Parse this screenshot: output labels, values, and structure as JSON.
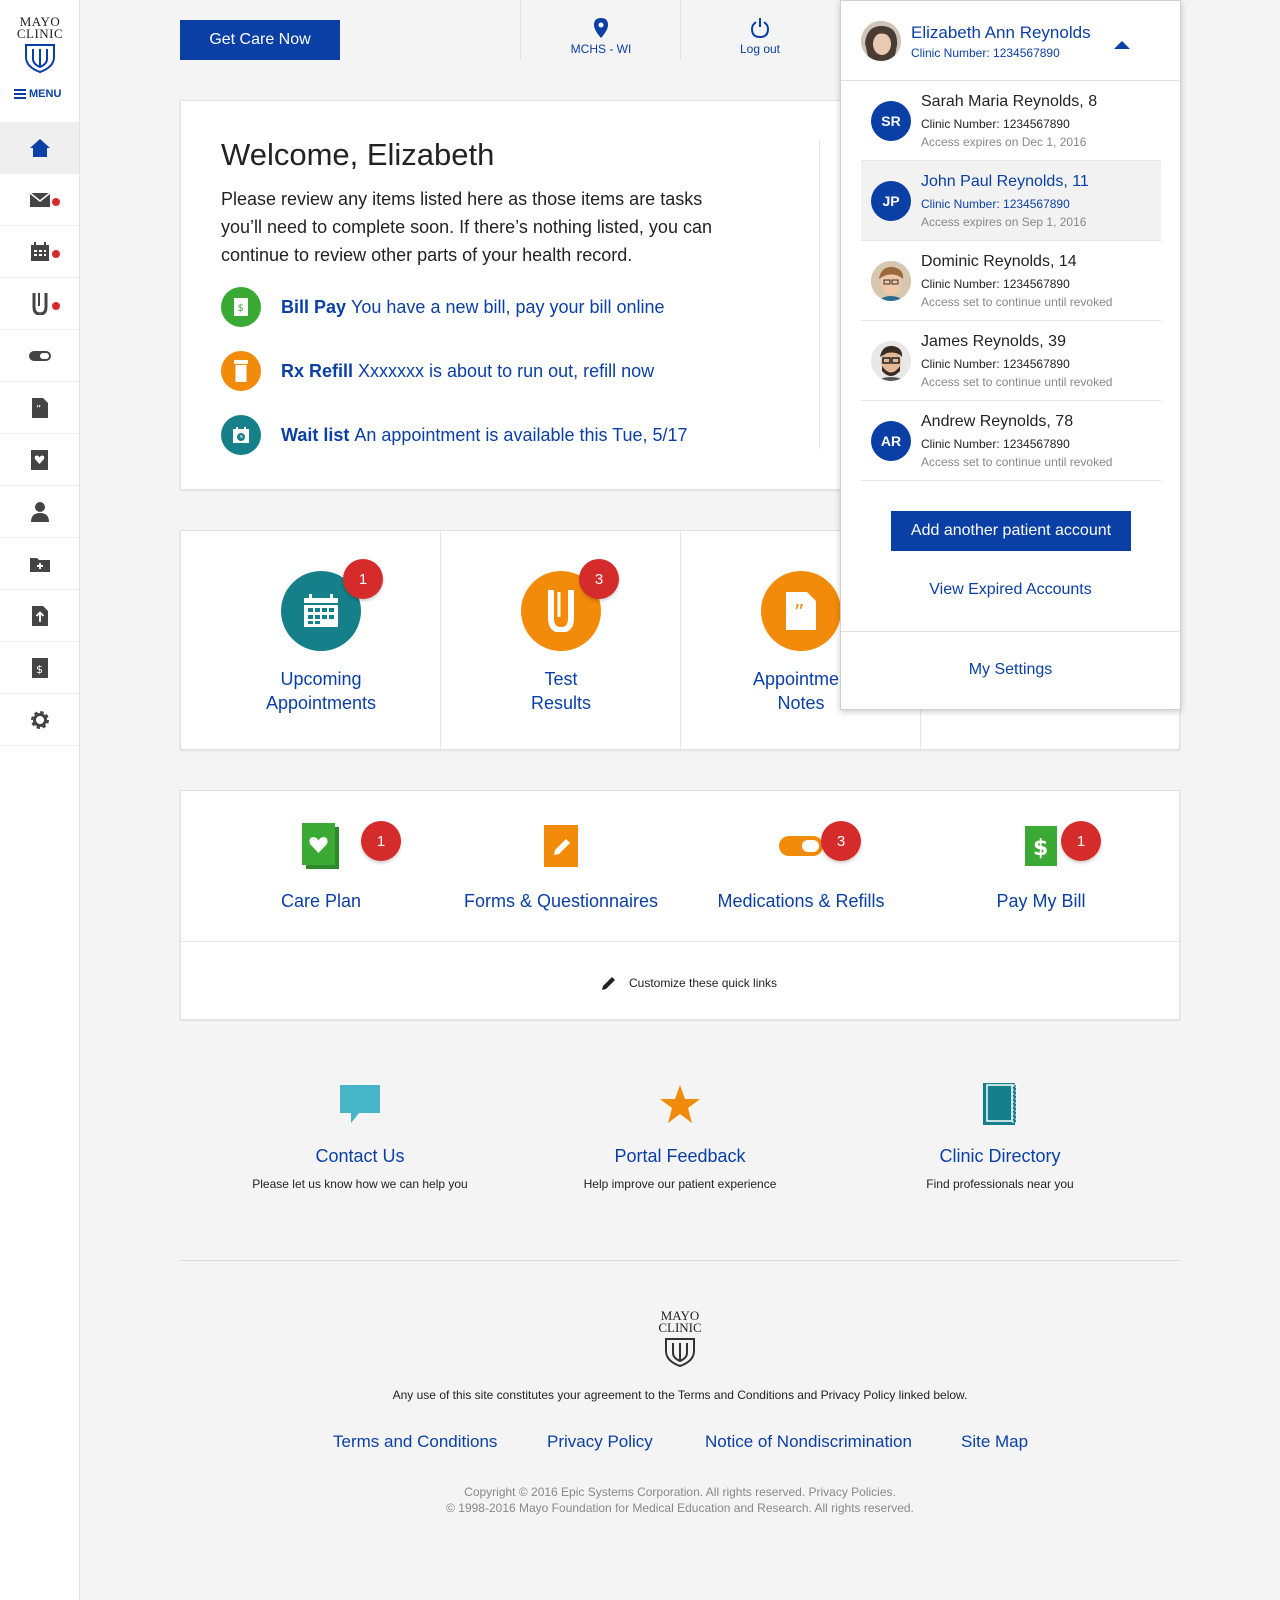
{
  "brand": {
    "logo_line1": "MAYO",
    "logo_line2": "CLINIC",
    "menu_label": "MENU"
  },
  "colors": {
    "primary": "#0a3fa6",
    "alert": "#d52b2b",
    "green": "#3aaa35",
    "orange": "#f28a0a",
    "teal": "#157f8a"
  },
  "sidebar": {
    "items": [
      {
        "icon": "home-icon",
        "active": true,
        "dot": false
      },
      {
        "icon": "mail-icon",
        "dot": true
      },
      {
        "icon": "calendar-icon",
        "dot": true
      },
      {
        "icon": "test-tube-icon",
        "dot": true
      },
      {
        "icon": "pill-icon",
        "dot": false
      },
      {
        "icon": "notes-icon",
        "dot": false
      },
      {
        "icon": "care-plan-icon",
        "dot": false
      },
      {
        "icon": "doctor-icon",
        "dot": false
      },
      {
        "icon": "folder-plus-icon",
        "dot": false
      },
      {
        "icon": "upload-icon",
        "dot": false
      },
      {
        "icon": "bill-icon",
        "dot": false
      },
      {
        "icon": "gear-icon",
        "dot": false
      }
    ]
  },
  "topbar": {
    "get_care": "Get Care Now",
    "location": "MCHS - WI",
    "logout": "Log out"
  },
  "welcome": {
    "title": "Welcome, Elizabeth",
    "body": "Please review any items listed here as those items are tasks you’ll need to complete soon. If there’s nothing listed, you can continue to review other parts of your health record.",
    "tasks": [
      {
        "title": "Bill Pay",
        "text": "You have a new bill, pay your bill online",
        "color": "#3aaa35",
        "icon": "dollar-icon"
      },
      {
        "title": "Rx Refill",
        "text": "Xxxxxxx is about to run out, refill now",
        "color": "#f28a0a",
        "icon": "pill-bottle-icon"
      },
      {
        "title": "Wait list",
        "text": "An appointment is available this Tue, 5/17",
        "color": "#157f8a",
        "icon": "clock-calendar-icon"
      }
    ]
  },
  "summary": [
    {
      "line1": "Upcoming",
      "line2": "Appointments",
      "badge": "1",
      "color": "#157f8a"
    },
    {
      "line1": "Test",
      "line2": "Results",
      "badge": "3",
      "color": "#f28a0a"
    },
    {
      "line1": "Appointmen",
      "line2": "Notes",
      "badge": "",
      "color": "#f28a0a"
    }
  ],
  "quick_links": [
    {
      "label": "Care Plan",
      "badge": "1"
    },
    {
      "label": "Forms & Questionnaires",
      "badge": ""
    },
    {
      "label": "Medications & Refills",
      "badge": "3"
    },
    {
      "label": "Pay My Bill",
      "badge": "1"
    }
  ],
  "customize_label": "Customize these quick links",
  "help": [
    {
      "title": "Contact Us",
      "sub": "Please let us know how we can help you"
    },
    {
      "title": "Portal Feedback",
      "sub": "Help improve our patient experience"
    },
    {
      "title": "Clinic Directory",
      "sub": "Find professionals near you"
    }
  ],
  "footer": {
    "note": "Any use of this site constitutes your agreement to the Terms and Conditions and Privacy Policy linked below.",
    "links": [
      "Terms and Conditions",
      "Privacy Policy",
      "Notice of Nondiscrimination",
      "Site Map"
    ],
    "copy1": "Copyright © 2016 Epic Systems Corporation. All rights reserved. Privacy Policies.",
    "copy2": "© 1998-2016 Mayo Foundation for Medical Education and Research. All rights reserved."
  },
  "account_menu": {
    "current_name": "Elizabeth Ann Reynolds",
    "current_clinic": "Clinic Number: 1234567890",
    "accounts": [
      {
        "initials": "SR",
        "name": "Sarah Maria Reynolds, 8",
        "clinic": "Clinic Number: 1234567890",
        "access": "Access expires on Dec 1, 2016",
        "photo": false,
        "selected": false
      },
      {
        "initials": "JP",
        "name": "John Paul Reynolds, 11",
        "clinic": "Clinic Number: 1234567890",
        "access": "Access expires on Sep 1, 2016",
        "photo": false,
        "selected": true
      },
      {
        "initials": "",
        "name": "Dominic Reynolds, 14",
        "clinic": "Clinic Number: 1234567890",
        "access": "Access set to continue until revoked",
        "photo": true,
        "selected": false
      },
      {
        "initials": "",
        "name": "James Reynolds, 39",
        "clinic": "Clinic Number: 1234567890",
        "access": "Access set to continue until revoked",
        "photo": true,
        "selected": false
      },
      {
        "initials": "AR",
        "name": "Andrew Reynolds, 78",
        "clinic": "Clinic Number: 1234567890",
        "access": "Access set to continue until revoked",
        "photo": false,
        "selected": false
      }
    ],
    "add_account": "Add another patient account",
    "view_expired": "View Expired Accounts",
    "settings": "My Settings"
  }
}
